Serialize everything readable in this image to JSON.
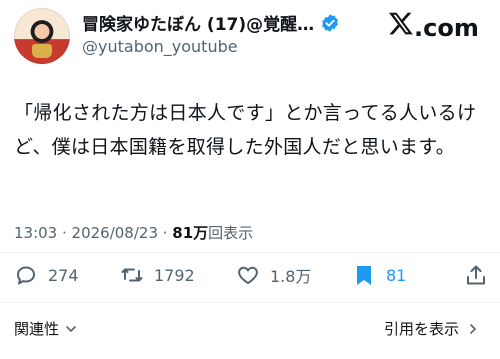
{
  "header": {
    "display_name": "冒険家ゆたぼん (17)@覚醒…",
    "handle": "@yutabon_youtube",
    "logo_text": ".com",
    "verified_icon": "verified-badge-icon",
    "verified_color": "#1d9bf0"
  },
  "tweet": {
    "text": "「帰化された方は日本人です」とか言ってる人いるけど、僕は日本国籍を取得した外国人だと思います。"
  },
  "meta": {
    "time_date": "13:03 · 2026/08/23 · ",
    "views_count": "81万",
    "views_label": "回表示"
  },
  "actions": {
    "replies": "274",
    "retweets": "1792",
    "likes": "1.8万",
    "bookmarks": "81",
    "accent": "#1d9bf0"
  },
  "footer": {
    "related_label": "関連性",
    "quote_label": "引用を表示"
  }
}
